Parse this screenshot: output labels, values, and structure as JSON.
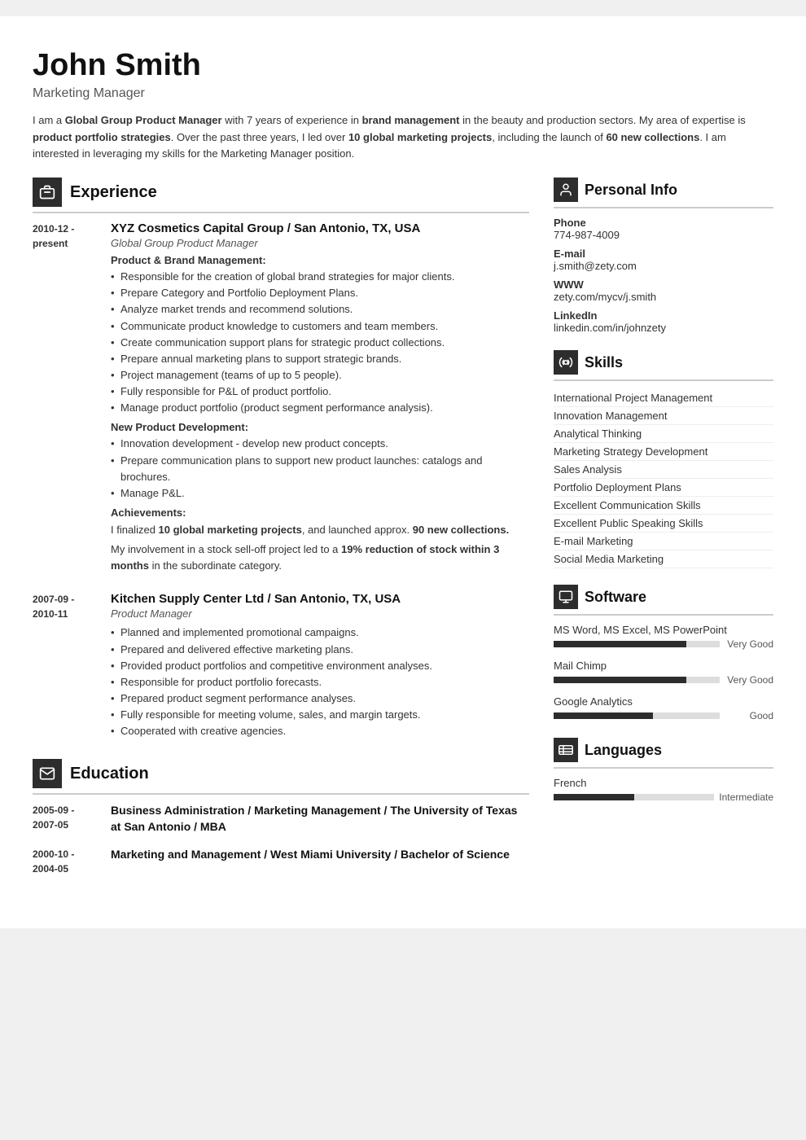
{
  "header": {
    "name": "John Smith",
    "title": "Marketing Manager",
    "summary_html": "I am a <strong>Global Group Product Manager</strong> with 7 years of experience in <strong>brand management</strong> in the beauty and production sectors. My area of expertise is <strong>product portfolio strategies</strong>. Over the past three years, I led over <strong>10 global marketing projects</strong>, including the launch of <strong>60 new collections</strong>. I am interested in leveraging my skills for the Marketing Manager position."
  },
  "experience": {
    "section_label": "Experience",
    "entries": [
      {
        "date_start": "2010-12 -",
        "date_end": "present",
        "company": "XYZ Cosmetics Capital Group / San Antonio, TX, USA",
        "role": "Global Group Product Manager",
        "sections": [
          {
            "label": "Product & Brand Management:",
            "bullets": [
              "Responsible for the creation of global brand strategies for major clients.",
              "Prepare Category and Portfolio Deployment Plans.",
              "Analyze market trends and recommend solutions.",
              "Communicate product knowledge to customers and team members.",
              "Create communication support plans for strategic product collections.",
              "Prepare annual marketing plans to support strategic brands.",
              "Project management (teams of up to 5 people).",
              "Fully responsible for P&L of product portfolio.",
              "Manage product portfolio (product segment performance analysis)."
            ]
          },
          {
            "label": "New Product Development:",
            "bullets": [
              "Innovation development - develop new product concepts.",
              "Prepare communication plans to support new product launches: catalogs and brochures.",
              "Manage P&L."
            ]
          }
        ],
        "achievements_label": "Achievements:",
        "achievements_html": "I finalized <strong>10 global marketing projects</strong>, and launched approx. <strong>90 new collections.</strong>",
        "achievements2_html": "My involvement in a stock sell-off project led to a <strong>19% reduction of stock within 3 months</strong> in the subordinate category."
      },
      {
        "date_start": "2007-09 -",
        "date_end": "2010-11",
        "company": "Kitchen Supply Center Ltd / San Antonio, TX, USA",
        "role": "Product Manager",
        "sections": [
          {
            "label": null,
            "bullets": [
              "Planned and implemented promotional campaigns.",
              "Prepared and delivered effective marketing plans.",
              "Provided product portfolios and competitive environment analyses.",
              "Responsible for product portfolio forecasts.",
              "Prepared product segment performance analyses.",
              "Fully responsible for meeting volume, sales, and margin targets.",
              "Cooperated with creative agencies."
            ]
          }
        ],
        "achievements_label": null,
        "achievements_html": null,
        "achievements2_html": null
      }
    ]
  },
  "education": {
    "section_label": "Education",
    "entries": [
      {
        "date_start": "2005-09 -",
        "date_end": "2007-05",
        "degree": "Business Administration / Marketing Management / The University of Texas at San Antonio / MBA"
      },
      {
        "date_start": "2000-10 -",
        "date_end": "2004-05",
        "degree": "Marketing and Management / West Miami University / Bachelor of Science"
      }
    ]
  },
  "personal_info": {
    "section_label": "Personal Info",
    "items": [
      {
        "label": "Phone",
        "value": "774-987-4009"
      },
      {
        "label": "E-mail",
        "value": "j.smith@zety.com"
      },
      {
        "label": "WWW",
        "value": "zety.com/mycv/j.smith"
      },
      {
        "label": "LinkedIn",
        "value": "linkedin.com/in/johnzety"
      }
    ]
  },
  "skills": {
    "section_label": "Skills",
    "items": [
      "International Project Management",
      "Innovation Management",
      "Analytical Thinking",
      "Marketing Strategy Development",
      "Sales Analysis",
      "Portfolio Deployment Plans",
      "Excellent Communication Skills",
      "Excellent Public Speaking Skills",
      "E-mail Marketing",
      "Social Media Marketing"
    ]
  },
  "software": {
    "section_label": "Software",
    "items": [
      {
        "name": "MS Word, MS Excel, MS PowerPoint",
        "level": "Very Good",
        "percent": 80
      },
      {
        "name": "Mail Chimp",
        "level": "Very Good",
        "percent": 80
      },
      {
        "name": "Google Analytics",
        "level": "Good",
        "percent": 60
      }
    ]
  },
  "languages": {
    "section_label": "Languages",
    "items": [
      {
        "name": "French",
        "level": "Intermediate",
        "percent": 50
      }
    ]
  },
  "icons": {
    "experience": "🗂",
    "education": "✉",
    "personal": "👤",
    "skills": "⚙",
    "software": "🖥",
    "languages": "🏳"
  }
}
